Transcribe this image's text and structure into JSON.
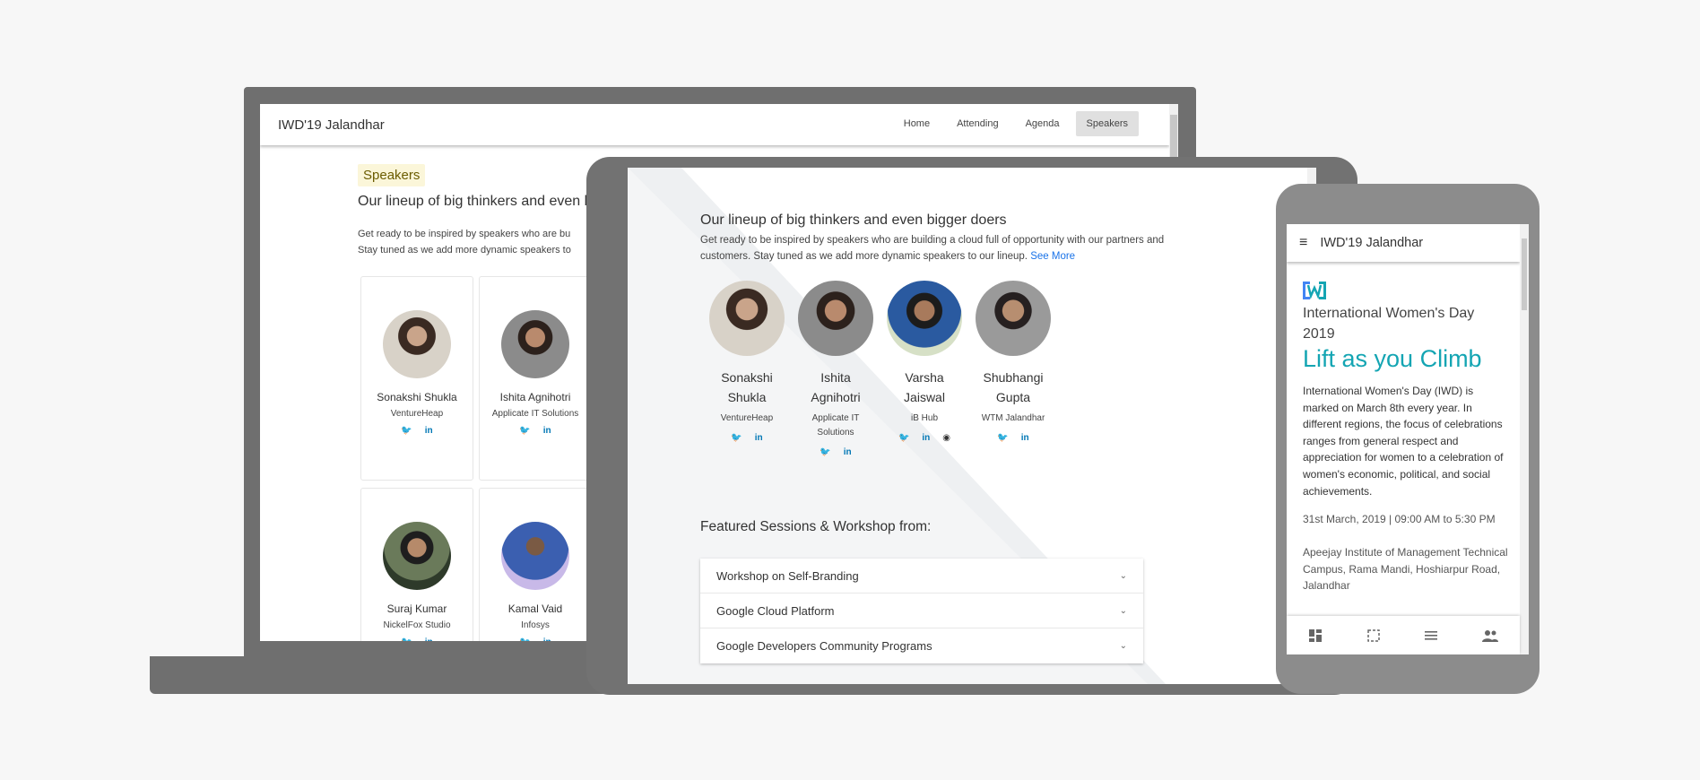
{
  "laptop": {
    "brand": "IWD'19 Jalandhar",
    "nav": [
      "Home",
      "Attending",
      "Agenda",
      "Speakers"
    ],
    "active_nav": "Speakers",
    "section_badge": "Speakers",
    "heading_partial": "Our lineup of big thinkers and even b",
    "desc_line1_partial": "Get ready to be inspired by speakers who are bu",
    "desc_line2_partial": "Stay tuned as we add more dynamic speakers to",
    "cards": [
      {
        "name": "Sonakshi Shukla",
        "org": "VentureHeap"
      },
      {
        "name": "Ishita Agnihotri",
        "org": "Applicate IT Solutions"
      },
      {
        "name": "Suraj Kumar",
        "org": "NickelFox Studio"
      },
      {
        "name": "Kamal Vaid",
        "org": "Infosys"
      }
    ]
  },
  "tablet": {
    "heading": "Our lineup of big thinkers and even bigger doers",
    "desc": "Get ready to be inspired by speakers who are building a cloud full of opportunity with our partners and customers. Stay tuned as we add more dynamic speakers to our lineup.",
    "see_more": "See More",
    "speakers": [
      {
        "name": "Sonakshi Shukla",
        "org": "VentureHeap",
        "socials": [
          "twitter",
          "linkedin"
        ]
      },
      {
        "name": "Ishita Agnihotri",
        "org": "Applicate IT Solutions",
        "socials": [
          "twitter",
          "linkedin"
        ]
      },
      {
        "name": "Varsha Jaiswal",
        "org": "iB Hub",
        "socials": [
          "twitter",
          "linkedin",
          "github"
        ]
      },
      {
        "name": "Shubhangi Gupta",
        "org": "WTM Jalandhar",
        "socials": [
          "twitter",
          "linkedin"
        ]
      }
    ],
    "featured_title": "Featured Sessions & Workshop from:",
    "sessions": [
      "Workshop on Self-Branding",
      "Google Cloud Platform",
      "Google Developers Community Programs"
    ]
  },
  "phone": {
    "title": "IWD'19 Jalandhar",
    "event_title": "International Women's Day 2019",
    "tagline": "Lift as you Climb",
    "body": "International Women's Day (IWD) is marked on March 8th every year. In different regions, the focus of celebrations ranges from general respect and appreciation for women to a celebration of women's economic, political, and social achievements.",
    "date": "31st March, 2019 | 09:00 AM to 5:30 PM",
    "venue": "Apeejay Institute of Management Technical Campus, Rama Mandi, Hoshiarpur Road, Jalandhar",
    "bottom_tabs": [
      "dashboard-icon",
      "crop-icon",
      "list-icon",
      "people-icon"
    ]
  },
  "icons": {
    "twitter": "🐦",
    "linkedin": "in",
    "github": "◉",
    "menu": "≡",
    "chevron": "⌄"
  },
  "colors": {
    "twitter": "#1da1f2",
    "linkedin": "#0077b5",
    "teal": "#14a5b3",
    "link": "#1a73e8"
  }
}
